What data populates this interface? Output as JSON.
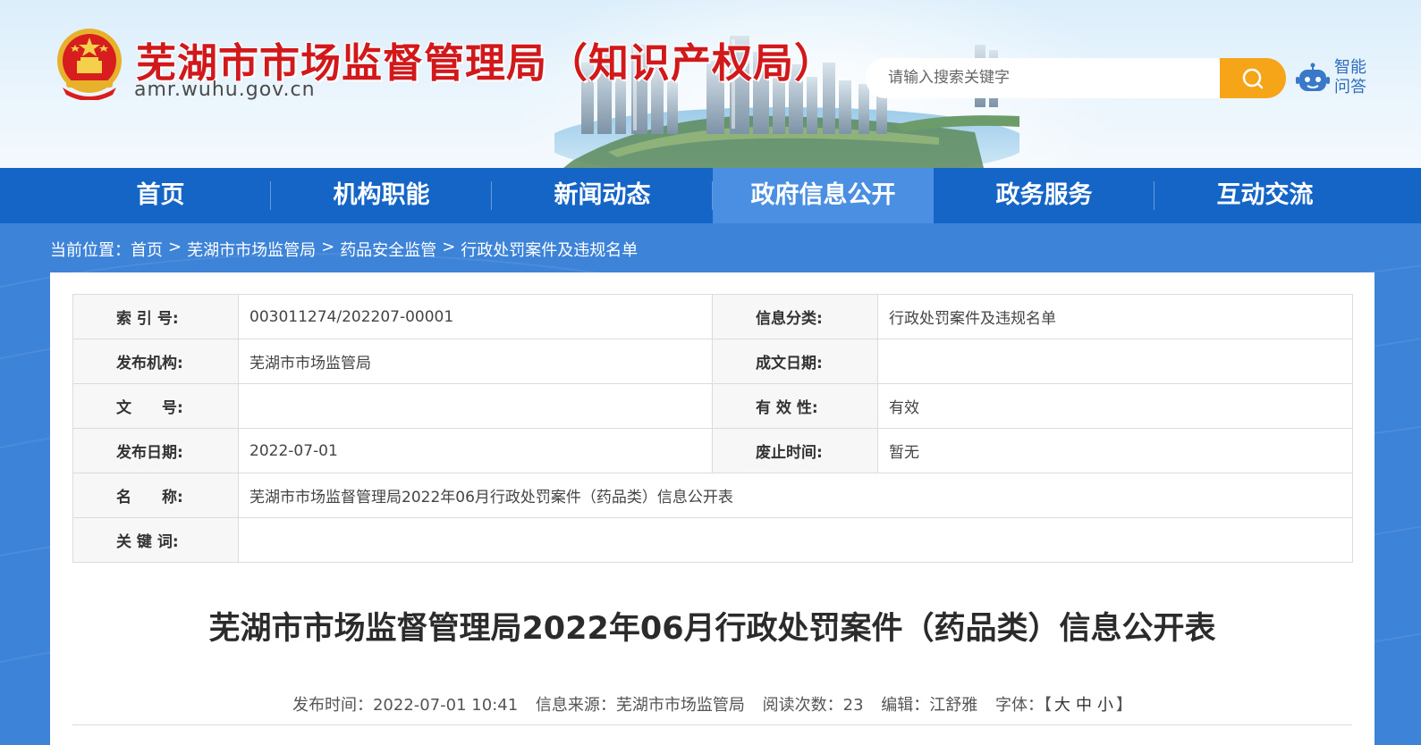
{
  "header": {
    "title": "芜湖市市场监督管理局（知识产权局）",
    "domain": "amr.wuhu.gov.cn",
    "search_placeholder": "请输入搜索关键字",
    "assistant_line1": "智能",
    "assistant_line2": "问答"
  },
  "nav": {
    "items": [
      {
        "label": "首页"
      },
      {
        "label": "机构职能"
      },
      {
        "label": "新闻动态"
      },
      {
        "label": "政府信息公开"
      },
      {
        "label": "政务服务"
      },
      {
        "label": "互动交流"
      }
    ],
    "active_index": 3
  },
  "breadcrumb": {
    "prefix": "当前位置：",
    "items": [
      "首页",
      "芜湖市市场监管局",
      "药品安全监管",
      "行政处罚案件及违规名单"
    ],
    "separator": ">"
  },
  "meta": {
    "index_label": "索 引 号:",
    "index_value": "003011274/202207-00001",
    "category_label": "信息分类:",
    "category_value": "行政处罚案件及违规名单",
    "publisher_label": "发布机构:",
    "publisher_value": "芜湖市市场监管局",
    "created_label": "成文日期:",
    "created_value": "",
    "docno_label": "文　　号:",
    "docno_value": "",
    "validity_label": "有 效 性:",
    "validity_value": "有效",
    "pubdate_label": "发布日期:",
    "pubdate_value": "2022-07-01",
    "expire_label": "废止时间:",
    "expire_value": "暂无",
    "name_label": "名　　称:",
    "name_value": "芜湖市市场监督管理局2022年06月行政处罚案件（药品类）信息公开表",
    "keywords_label": "关 键 词:",
    "keywords_value": ""
  },
  "article": {
    "title": "芜湖市市场监督管理局2022年06月行政处罚案件（药品类）信息公开表",
    "publish_time": "发布时间：2022-07-01 10:41",
    "source": "信息来源：芜湖市市场监管局",
    "views": "阅读次数：23",
    "editor": "编辑：江舒雅",
    "font_label": "字体：",
    "font_open": "【",
    "font_large": "大",
    "font_medium": "中",
    "font_small": "小",
    "font_close": "】"
  },
  "colors": {
    "nav_bg": "#1565c7",
    "nav_active": "#4b8fe2",
    "body_bg": "#3d83d8",
    "title_red": "#d1191c",
    "search_orange": "#f6a418"
  }
}
